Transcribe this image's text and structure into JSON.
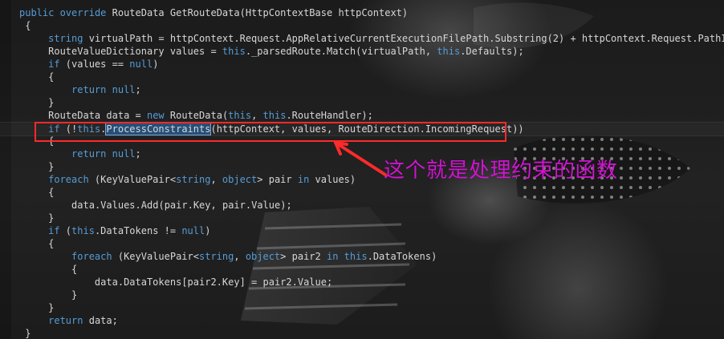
{
  "editor": {
    "code_lines": [
      {
        "text": "public override RouteData GetRouteData(HttpContextBase httpContext)",
        "selected": ""
      },
      {
        "text": " {",
        "selected": ""
      },
      {
        "text": "     string virtualPath = httpContext.Request.AppRelativeCurrentExecutionFilePath.Substring(2) + httpContext.Request.PathInfo;",
        "selected": ""
      },
      {
        "text": "     RouteValueDictionary values = this._parsedRoute.Match(virtualPath, this.Defaults);",
        "selected": ""
      },
      {
        "text": "     if (values == null)",
        "selected": ""
      },
      {
        "text": "     {",
        "selected": ""
      },
      {
        "text": "         return null;",
        "selected": ""
      },
      {
        "text": "     }",
        "selected": ""
      },
      {
        "text": "     RouteData data = new RouteData(this, this.RouteHandler);",
        "selected": ""
      },
      {
        "text": "     if (!this.ProcessConstraints(httpContext, values, RouteDirection.IncomingRequest))",
        "selected": "ProcessConstraints"
      },
      {
        "text": "     {",
        "selected": ""
      },
      {
        "text": "         return null;",
        "selected": ""
      },
      {
        "text": "     }",
        "selected": ""
      },
      {
        "text": "     foreach (KeyValuePair<string, object> pair in values)",
        "selected": ""
      },
      {
        "text": "     {",
        "selected": ""
      },
      {
        "text": "         data.Values.Add(pair.Key, pair.Value);",
        "selected": ""
      },
      {
        "text": "     }",
        "selected": ""
      },
      {
        "text": "     if (this.DataTokens != null)",
        "selected": ""
      },
      {
        "text": "     {",
        "selected": ""
      },
      {
        "text": "         foreach (KeyValuePair<string, object> pair2 in this.DataTokens)",
        "selected": ""
      },
      {
        "text": "         {",
        "selected": ""
      },
      {
        "text": "             data.DataTokens[pair2.Key] = pair2.Value;",
        "selected": ""
      },
      {
        "text": "         }",
        "selected": ""
      },
      {
        "text": "     }",
        "selected": ""
      },
      {
        "text": "     return data;",
        "selected": ""
      },
      {
        "text": " }",
        "selected": ""
      }
    ],
    "keywords": [
      "public",
      "override",
      "string",
      "this",
      "if",
      "null",
      "return",
      "new",
      "foreach",
      "in",
      "object"
    ],
    "current_line_index": 9
  },
  "annotation": {
    "callout_text": "这个就是处理约束的函数"
  },
  "colors": {
    "keyword": "#569cd6",
    "plain": "#d7d7d7",
    "selection": "#264f78",
    "callout_red": "#ff2a2a",
    "callout_text": "#d014d0"
  },
  "icons": {
    "callout_arrow": "arrow-icon"
  }
}
